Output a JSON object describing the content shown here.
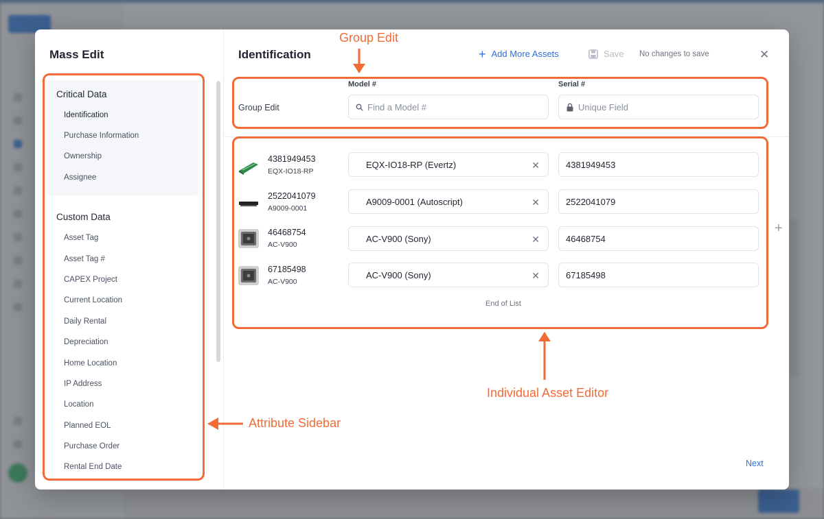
{
  "mass_edit": {
    "title": "Mass Edit",
    "critical": {
      "title": "Critical Data",
      "items": [
        "Identification",
        "Purchase Information",
        "Ownership",
        "Assignee"
      ]
    },
    "custom": {
      "title": "Custom Data",
      "items": [
        "Asset Tag",
        "Asset Tag #",
        "CAPEX Project",
        "Current Location",
        "Daily Rental",
        "Depreciation",
        "Home Location",
        "IP Address",
        "Location",
        "Planned EOL",
        "Purchase Order",
        "Rental End Date"
      ]
    }
  },
  "header": {
    "title": "Identification",
    "add_more_label": "Add More Assets",
    "save_label": "Save",
    "no_changes": "No changes to save"
  },
  "columns": {
    "model": "Model #",
    "serial": "Serial #"
  },
  "group_edit": {
    "label": "Group Edit",
    "model_placeholder": "Find a Model #",
    "serial_placeholder": "Unique Field"
  },
  "assets": [
    {
      "id": "4381949453",
      "model": "EQX-IO18-RP",
      "model_display": "EQX-IO18-RP (Evertz)",
      "serial": "4381949453"
    },
    {
      "id": "2522041079",
      "model": "A9009-0001",
      "model_display": "A9009-0001 (Autoscript)",
      "serial": "2522041079"
    },
    {
      "id": "46468754",
      "model": "AC-V900",
      "model_display": "AC-V900 (Sony)",
      "serial": "46468754"
    },
    {
      "id": "67185498",
      "model": "AC-V900",
      "model_display": "AC-V900 (Sony)",
      "serial": "67185498"
    }
  ],
  "end_of_list": "End of List",
  "next_label": "Next",
  "annotations": {
    "group_edit": "Group Edit",
    "individual": "Individual Asset Editor",
    "sidebar": "Attribute Sidebar"
  },
  "colors": {
    "accent": "#2e6fd8",
    "annotation": "#f26a35"
  }
}
